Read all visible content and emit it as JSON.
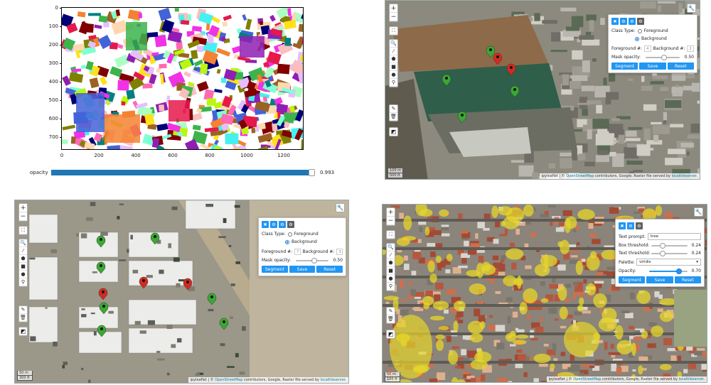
{
  "plot": {
    "yticks": [
      "0",
      "100",
      "200",
      "300",
      "400",
      "500",
      "600",
      "700"
    ],
    "xticks": [
      "0",
      "200",
      "400",
      "600",
      "800",
      "1000",
      "1200"
    ],
    "slider_label": "opacity",
    "slider_value": "0.993",
    "slider_fraction": 0.993
  },
  "zoom": {
    "in": "+",
    "out": "−"
  },
  "panel_sam": {
    "class_type_label": "Class Type:",
    "foreground_label": "Foreground",
    "background_label": "Background",
    "foreground_count_label": "Foreground #:",
    "background_count_label": "Background #:",
    "mask_opacity_label": "Mask opacity:",
    "mask_opacity_value": "0.50",
    "segment": "Segment",
    "save": "Save",
    "reset": "Reset"
  },
  "map2": {
    "fg_count": "4",
    "bg_count": "2",
    "scale_m": "100 m",
    "scale_ft": "500 ft"
  },
  "map3": {
    "fg_count": "7",
    "bg_count": "3",
    "scale_m": "50 m",
    "scale_ft": "300 ft"
  },
  "panel_text": {
    "text_prompt_label": "Text prompt:",
    "text_prompt_value": "tree",
    "box_threshold_label": "Box threshold:",
    "box_threshold_value": "0.24",
    "text_threshold_label": "Text threshold:",
    "text_threshold_value": "0.24",
    "palette_label": "Palette:",
    "palette_value": "viridis",
    "opacity_label": "Opacity:",
    "opacity_value": "0.70",
    "segment": "Segment",
    "save": "Save",
    "reset": "Reset"
  },
  "map4": {
    "scale_m": "50 m",
    "scale_ft": "100 ft"
  },
  "attribution": {
    "prefix": "ipyleaflet | © ",
    "osm": "OpenStreetMap",
    "middle": " contributors, Google, Raster file served by ",
    "server": "localtileserver",
    "suffix": "."
  },
  "colors": {
    "accent": "#2196f3",
    "slider_fill": "#1f77b4",
    "pin_green": "#3aa832",
    "pin_red": "#d42a1f",
    "mask_yellow": "#e6d52b"
  }
}
